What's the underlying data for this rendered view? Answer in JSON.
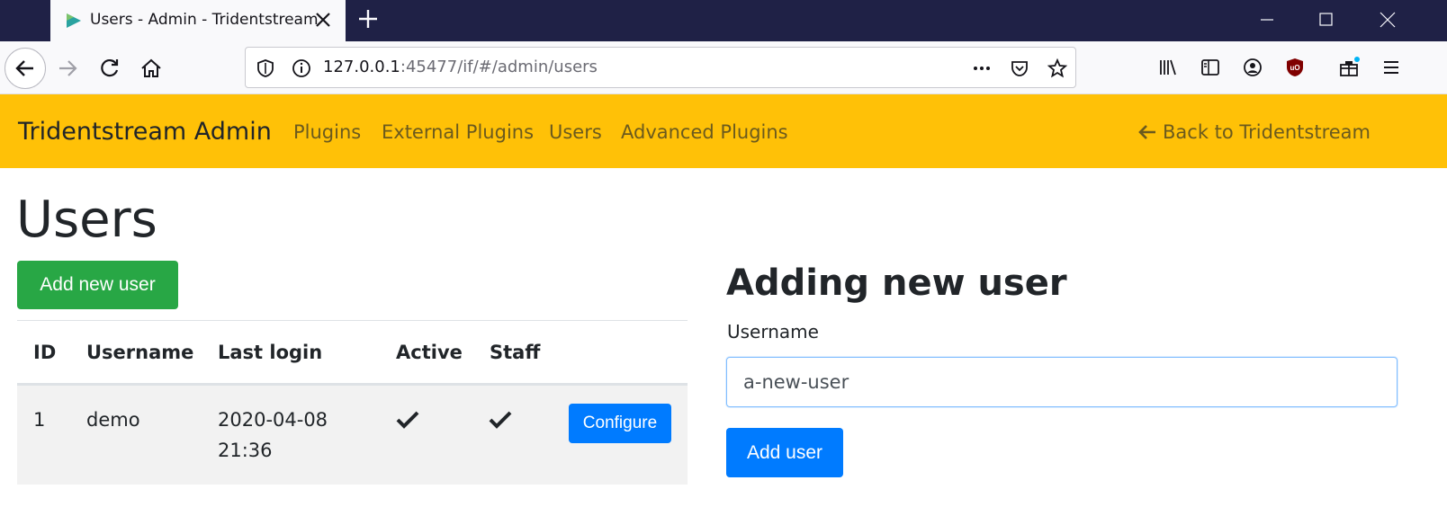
{
  "browser": {
    "tab_title": "Users - Admin - Tridentstream",
    "url_host": "127.0.0.1",
    "url_rest": ":45477/if/#/admin/users"
  },
  "app": {
    "brand": "Tridentstream Admin",
    "nav": [
      "Plugins",
      "External Plugins",
      "Users",
      "Advanced Plugins"
    ],
    "back_link": "Back to Tridentstream",
    "accent_color": "#ffc107"
  },
  "users_page": {
    "title": "Users",
    "add_button": "Add new user",
    "table": {
      "headers": [
        "ID",
        "Username",
        "Last login",
        "Active",
        "Staff"
      ],
      "rows": [
        {
          "id": "1",
          "username": "demo",
          "last_login_date": "2020-04-08",
          "last_login_time": "21:36",
          "active": true,
          "staff": true,
          "action": "Configure"
        }
      ]
    }
  },
  "new_user_form": {
    "title": "Adding new user",
    "username_label": "Username",
    "username_value": "a-new-user",
    "submit": "Add user"
  }
}
